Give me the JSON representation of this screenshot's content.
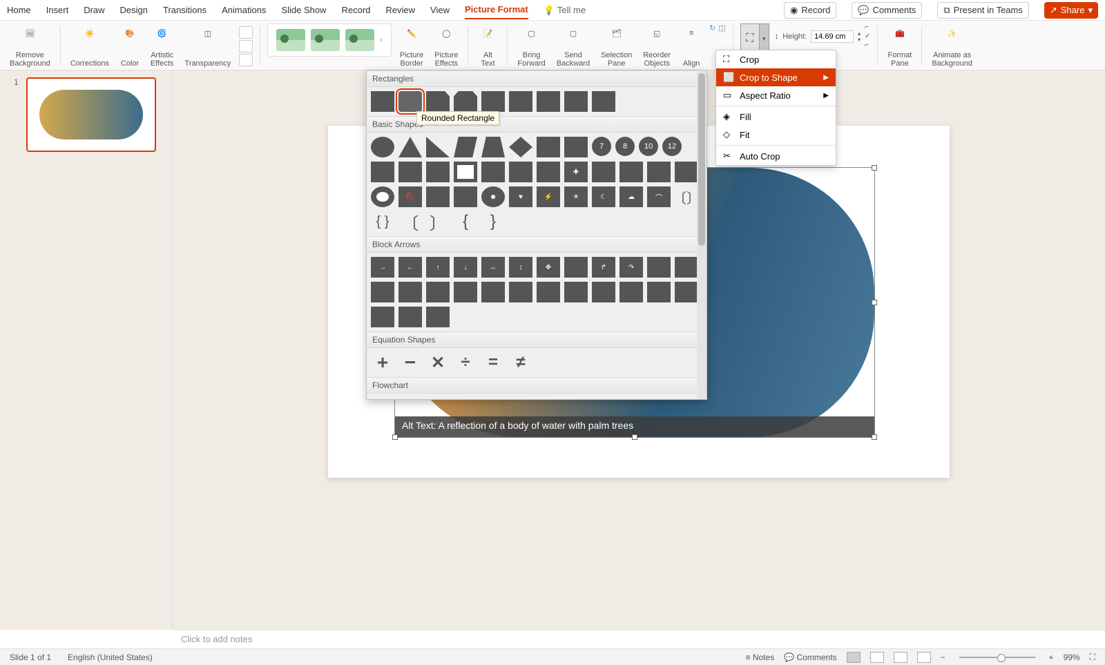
{
  "tabs": {
    "home": "Home",
    "insert": "Insert",
    "draw": "Draw",
    "design": "Design",
    "transitions": "Transitions",
    "animations": "Animations",
    "slideshow": "Slide Show",
    "record": "Record",
    "review": "Review",
    "view": "View",
    "pictureformat": "Picture Format",
    "tellme": "Tell me"
  },
  "topbar": {
    "record": "Record",
    "comments": "Comments",
    "presentteams": "Present in Teams",
    "share": "Share"
  },
  "ribbon": {
    "removebg": "Remove\nBackground",
    "corrections": "Corrections",
    "color": "Color",
    "artistic": "Artistic\nEffects",
    "transparency": "Transparency",
    "border": "Picture\nBorder",
    "effects": "Picture\nEffects",
    "alttext": "Alt\nText",
    "bringfwd": "Bring\nForward",
    "sendback": "Send\nBackward",
    "selpane": "Selection\nPane",
    "reorder": "Reorder\nObjects",
    "align": "Align",
    "height_label": "Height:",
    "height_value": "14.69 cm",
    "formatpane": "Format\nPane",
    "animbg": "Animate as\nBackground"
  },
  "cropmenu": {
    "crop": "Crop",
    "croptoshape": "Crop to Shape",
    "aspect": "Aspect Ratio",
    "fill": "Fill",
    "fit": "Fit",
    "autocrop": "Auto Crop"
  },
  "shapes": {
    "rectangles": "Rectangles",
    "basic": "Basic Shapes",
    "arrows": "Block Arrows",
    "equation": "Equation Shapes",
    "flowchart": "Flowchart",
    "badges": [
      "7",
      "8",
      "10",
      "12"
    ],
    "tooltip": "Rounded Rectangle"
  },
  "thumb": {
    "num": "1"
  },
  "alttext": "Alt Text: A reflection of a body of water with palm trees",
  "notes_placeholder": "Click to add notes",
  "status": {
    "slide": "Slide 1 of 1",
    "lang": "English (United States)",
    "notes": "Notes",
    "comments": "Comments",
    "zoom": "99%"
  }
}
